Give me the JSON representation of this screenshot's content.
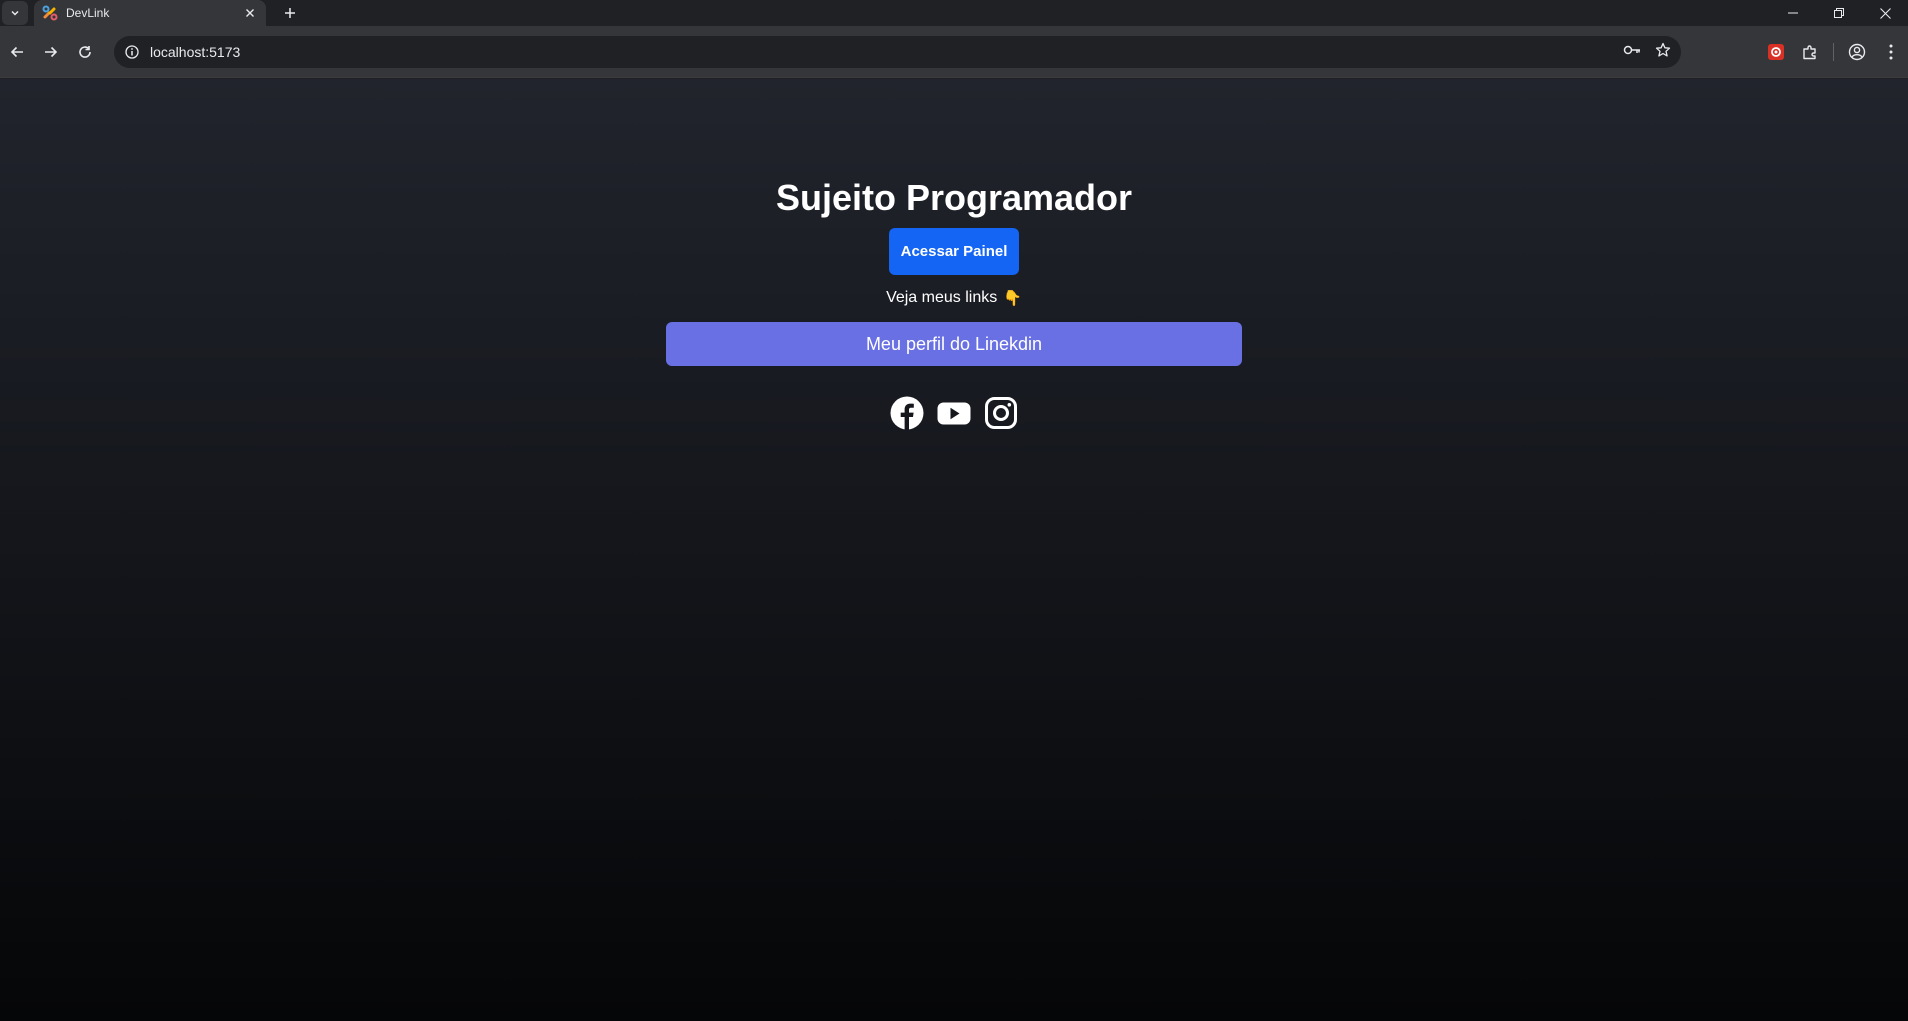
{
  "browser": {
    "tab_title": "DevLink",
    "url": "localhost:5173"
  },
  "page": {
    "title": "Sujeito Programador",
    "panel_button_label": "Acessar Painel",
    "links_caption": "Veja meus links",
    "links_caption_emoji": "👇",
    "links": [
      {
        "label": "Meu perfil do Linekdin",
        "color": "#6970e3"
      }
    ],
    "socials": [
      "facebook-icon",
      "youtube-icon",
      "instagram-icon"
    ]
  },
  "colors": {
    "panel_button": "#1565f5",
    "link_button": "#6970e3"
  }
}
